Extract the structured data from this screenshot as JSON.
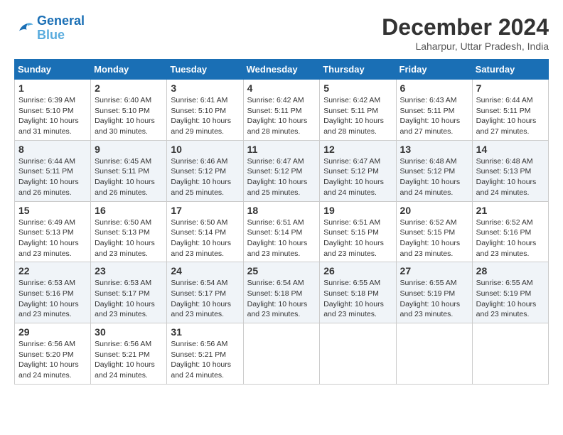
{
  "logo": {
    "line1": "General",
    "line2": "Blue"
  },
  "title": "December 2024",
  "location": "Laharpur, Uttar Pradesh, India",
  "weekdays": [
    "Sunday",
    "Monday",
    "Tuesday",
    "Wednesday",
    "Thursday",
    "Friday",
    "Saturday"
  ],
  "weeks": [
    [
      {
        "day": 1,
        "sunrise": "6:39 AM",
        "sunset": "5:10 PM",
        "daylight": "10 hours and 31 minutes."
      },
      {
        "day": 2,
        "sunrise": "6:40 AM",
        "sunset": "5:10 PM",
        "daylight": "10 hours and 30 minutes."
      },
      {
        "day": 3,
        "sunrise": "6:41 AM",
        "sunset": "5:10 PM",
        "daylight": "10 hours and 29 minutes."
      },
      {
        "day": 4,
        "sunrise": "6:42 AM",
        "sunset": "5:11 PM",
        "daylight": "10 hours and 28 minutes."
      },
      {
        "day": 5,
        "sunrise": "6:42 AM",
        "sunset": "5:11 PM",
        "daylight": "10 hours and 28 minutes."
      },
      {
        "day": 6,
        "sunrise": "6:43 AM",
        "sunset": "5:11 PM",
        "daylight": "10 hours and 27 minutes."
      },
      {
        "day": 7,
        "sunrise": "6:44 AM",
        "sunset": "5:11 PM",
        "daylight": "10 hours and 27 minutes."
      }
    ],
    [
      {
        "day": 8,
        "sunrise": "6:44 AM",
        "sunset": "5:11 PM",
        "daylight": "10 hours and 26 minutes."
      },
      {
        "day": 9,
        "sunrise": "6:45 AM",
        "sunset": "5:11 PM",
        "daylight": "10 hours and 26 minutes."
      },
      {
        "day": 10,
        "sunrise": "6:46 AM",
        "sunset": "5:12 PM",
        "daylight": "10 hours and 25 minutes."
      },
      {
        "day": 11,
        "sunrise": "6:47 AM",
        "sunset": "5:12 PM",
        "daylight": "10 hours and 25 minutes."
      },
      {
        "day": 12,
        "sunrise": "6:47 AM",
        "sunset": "5:12 PM",
        "daylight": "10 hours and 24 minutes."
      },
      {
        "day": 13,
        "sunrise": "6:48 AM",
        "sunset": "5:12 PM",
        "daylight": "10 hours and 24 minutes."
      },
      {
        "day": 14,
        "sunrise": "6:48 AM",
        "sunset": "5:13 PM",
        "daylight": "10 hours and 24 minutes."
      }
    ],
    [
      {
        "day": 15,
        "sunrise": "6:49 AM",
        "sunset": "5:13 PM",
        "daylight": "10 hours and 23 minutes."
      },
      {
        "day": 16,
        "sunrise": "6:50 AM",
        "sunset": "5:13 PM",
        "daylight": "10 hours and 23 minutes."
      },
      {
        "day": 17,
        "sunrise": "6:50 AM",
        "sunset": "5:14 PM",
        "daylight": "10 hours and 23 minutes."
      },
      {
        "day": 18,
        "sunrise": "6:51 AM",
        "sunset": "5:14 PM",
        "daylight": "10 hours and 23 minutes."
      },
      {
        "day": 19,
        "sunrise": "6:51 AM",
        "sunset": "5:15 PM",
        "daylight": "10 hours and 23 minutes."
      },
      {
        "day": 20,
        "sunrise": "6:52 AM",
        "sunset": "5:15 PM",
        "daylight": "10 hours and 23 minutes."
      },
      {
        "day": 21,
        "sunrise": "6:52 AM",
        "sunset": "5:16 PM",
        "daylight": "10 hours and 23 minutes."
      }
    ],
    [
      {
        "day": 22,
        "sunrise": "6:53 AM",
        "sunset": "5:16 PM",
        "daylight": "10 hours and 23 minutes."
      },
      {
        "day": 23,
        "sunrise": "6:53 AM",
        "sunset": "5:17 PM",
        "daylight": "10 hours and 23 minutes."
      },
      {
        "day": 24,
        "sunrise": "6:54 AM",
        "sunset": "5:17 PM",
        "daylight": "10 hours and 23 minutes."
      },
      {
        "day": 25,
        "sunrise": "6:54 AM",
        "sunset": "5:18 PM",
        "daylight": "10 hours and 23 minutes."
      },
      {
        "day": 26,
        "sunrise": "6:55 AM",
        "sunset": "5:18 PM",
        "daylight": "10 hours and 23 minutes."
      },
      {
        "day": 27,
        "sunrise": "6:55 AM",
        "sunset": "5:19 PM",
        "daylight": "10 hours and 23 minutes."
      },
      {
        "day": 28,
        "sunrise": "6:55 AM",
        "sunset": "5:19 PM",
        "daylight": "10 hours and 23 minutes."
      }
    ],
    [
      {
        "day": 29,
        "sunrise": "6:56 AM",
        "sunset": "5:20 PM",
        "daylight": "10 hours and 24 minutes."
      },
      {
        "day": 30,
        "sunrise": "6:56 AM",
        "sunset": "5:21 PM",
        "daylight": "10 hours and 24 minutes."
      },
      {
        "day": 31,
        "sunrise": "6:56 AM",
        "sunset": "5:21 PM",
        "daylight": "10 hours and 24 minutes."
      },
      null,
      null,
      null,
      null
    ]
  ]
}
